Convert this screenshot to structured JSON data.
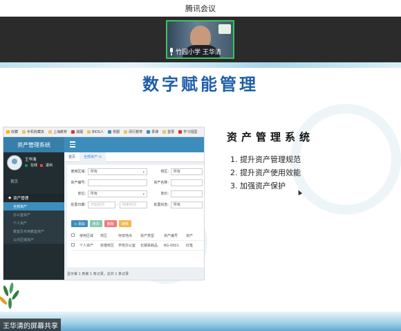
{
  "window": {
    "title": "腾讯会议"
  },
  "video": {
    "participant_label": "竹园小学 王华清"
  },
  "slide": {
    "title": "数字赋能管理",
    "system_title": "资产管理系统",
    "points": [
      "1. 提升资产管理规范",
      "2. 提升资产使用效能",
      "3. 加强资产保护"
    ]
  },
  "embedded_app": {
    "bookmarks": [
      "收藏",
      "手机收藏夹",
      "上海教育",
      "湖烟",
      "BIOS人",
      "校服",
      "闵行教育",
      "",
      "录课",
      "登录",
      "学习强国"
    ],
    "brand": "资产管理系统",
    "user": {
      "name": "王华清",
      "online": "在线",
      "logout": "退出"
    },
    "sidebar": {
      "home": "首页",
      "group": "资产管理",
      "items": [
        "全部资产",
        "办公室资产",
        "个人资产",
        "教室及专用教室资产",
        "公共区域资产"
      ]
    },
    "tabs": [
      "首页",
      "全部资产 ⊙"
    ],
    "form": {
      "use_area_label": "使用区域:",
      "use_area_value": "所有",
      "campus_label": "校区:",
      "campus_value": "所有",
      "asset_no_label": "资产编号:",
      "asset_name_label": "资产名称:",
      "unit_label": "单位:",
      "unit_value": "所有",
      "price_label": "单价:",
      "date_label": "处置日期:",
      "date_start_ph": "开始时间",
      "date_sep": "-",
      "date_end_ph": "结束时间",
      "status_label": "处置状态:",
      "status_value": "所有"
    },
    "buttons": [
      "+ 添加",
      "修改",
      "删除",
      "转移"
    ],
    "table": {
      "headers": [
        "使用区域",
        "校区",
        "存放地点",
        "资产类型",
        "资产编号",
        "资产"
      ],
      "rows": [
        [
          "个人资产",
          "张楷校区",
          "学校办公室",
          "长期易耗品",
          "BG-0001",
          "红笔"
        ]
      ]
    },
    "pager": "显示第 1 到第 1 条记录，总共 1 条记录"
  },
  "share_label": "王华清的屏幕共享",
  "colors": {
    "header_blue": "#3c8dbc",
    "sidebar_dark": "#222d32",
    "title_blue": "#1f5fa8",
    "video_border": "#3cc35a"
  }
}
